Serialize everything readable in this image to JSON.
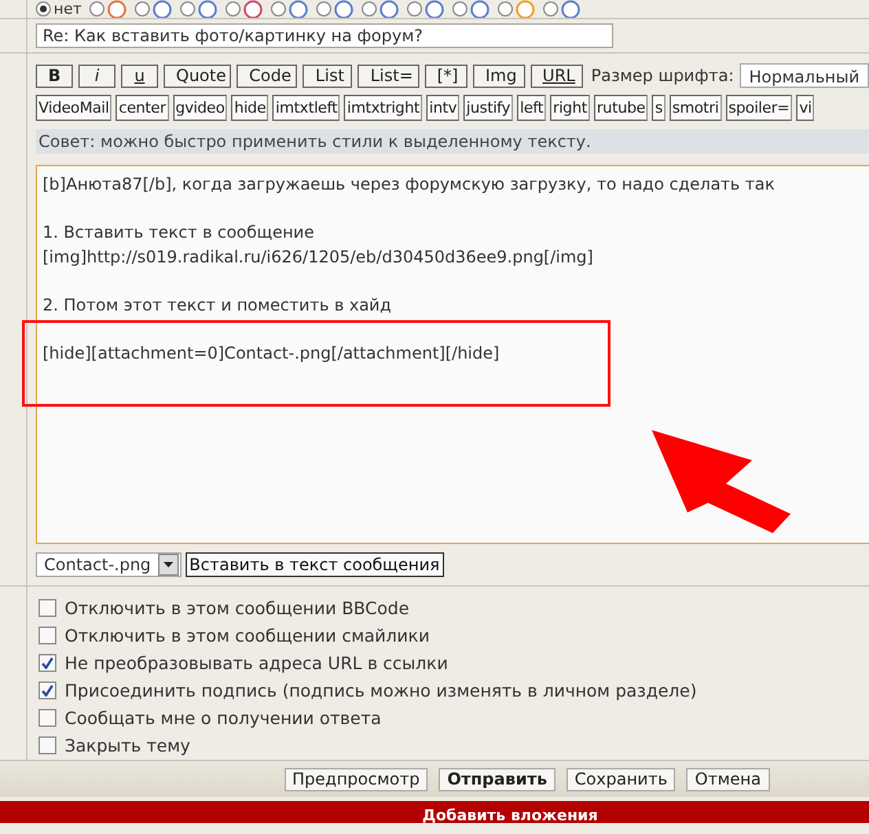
{
  "smiley_radios": [
    {
      "label": "нет",
      "selected": true
    },
    {
      "selected": false
    },
    {
      "selected": false
    },
    {
      "selected": false
    },
    {
      "selected": false
    },
    {
      "selected": false
    },
    {
      "selected": false
    },
    {
      "selected": false
    },
    {
      "selected": false
    },
    {
      "selected": false
    },
    {
      "selected": false
    },
    {
      "selected": false
    }
  ],
  "subject": {
    "value": "Re: Как вставить фото/картинку на форум?"
  },
  "toolbar_row_1": [
    {
      "label": "B",
      "kind": "bold"
    },
    {
      "label": "i",
      "kind": "italic"
    },
    {
      "label": "u",
      "kind": "underline"
    },
    {
      "label": "Quote",
      "kind": "plain"
    },
    {
      "label": "Code",
      "kind": "plain"
    },
    {
      "label": "List",
      "kind": "plain"
    },
    {
      "label": "List=",
      "kind": "plain"
    },
    {
      "label": "[*]",
      "kind": "plain"
    },
    {
      "label": "Img",
      "kind": "plain"
    },
    {
      "label": "URL",
      "kind": "underline"
    }
  ],
  "font_size": {
    "label": "Размер шрифта:",
    "value": "Нормальный"
  },
  "toolbar_row_2": [
    "VideoMail",
    "center",
    "gvideo",
    "hide",
    "imtxtleft",
    "imtxtright",
    "intv",
    "justify",
    "left",
    "right",
    "rutube",
    "s",
    "smotri",
    "spoiler=",
    "vi"
  ],
  "hint": "Совет: можно быстро применить стили к выделенному тексту.",
  "message": [
    [
      "[b]Анюта87[/b], когда загружаешь через форумскую загрузку, то надо сделать так"
    ],
    [
      "1. Вставить текст в сообщение",
      "[img]http://s019.radikal.ru/i626/1205/eb/d30450d36ee9.png[/img]"
    ],
    [
      "2. Потом этот текст и поместить в хайд"
    ],
    [
      "[hide][attachment=0]Contact-.png[/attachment][/hide]"
    ]
  ],
  "attachment": {
    "file": "Contact-.png",
    "insert_button": "Вставить в текст сообщения"
  },
  "options": [
    {
      "label": "Отключить в этом сообщении BBCode",
      "checked": false
    },
    {
      "label": "Отключить в этом сообщении смайлики",
      "checked": false
    },
    {
      "label": "Не преобразовывать адреса URL в ссылки",
      "checked": true
    },
    {
      "label": "Присоединить подпись (подпись можно изменять в личном разделе)",
      "checked": true
    },
    {
      "label": "Сообщать мне о получении ответа",
      "checked": false
    },
    {
      "label": "Закрыть тему",
      "checked": false
    }
  ],
  "actions": [
    {
      "label": "Предпросмотр",
      "kind": "normal"
    },
    {
      "label": "Отправить",
      "kind": "primary"
    },
    {
      "label": "Сохранить",
      "kind": "normal"
    },
    {
      "label": "Отмена",
      "kind": "normal"
    }
  ],
  "section_bar": "Добавить вложения"
}
